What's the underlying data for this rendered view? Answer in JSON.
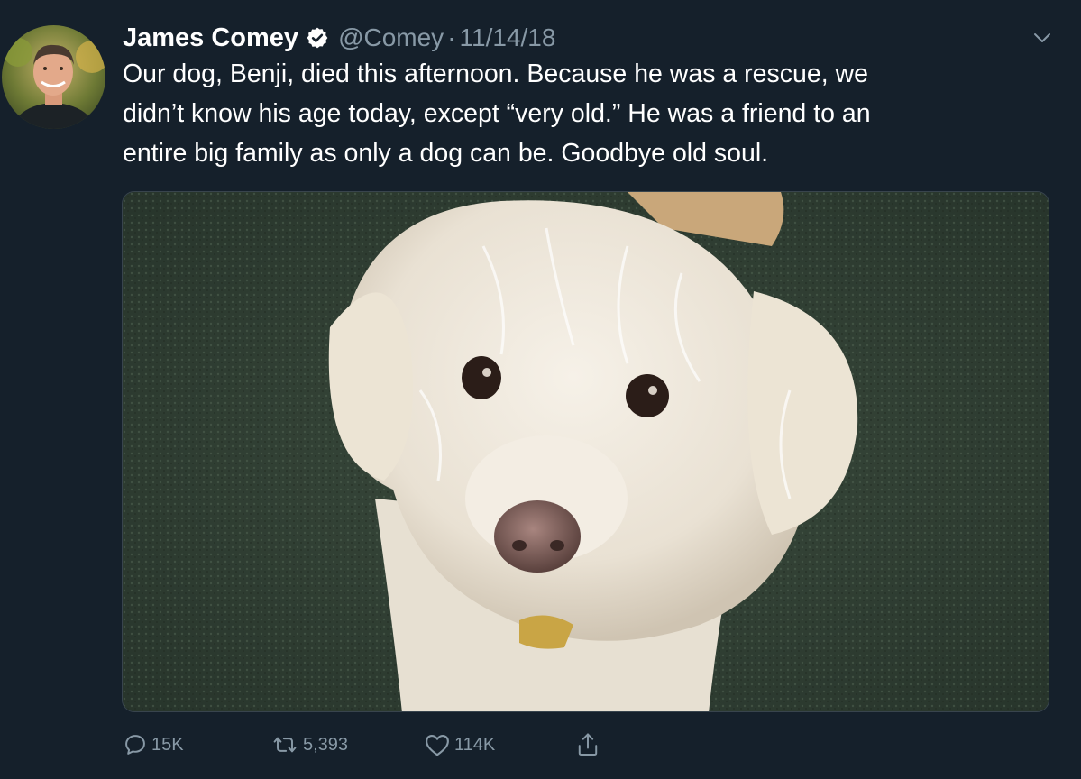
{
  "tweet": {
    "author_name": "James Comey",
    "handle": "@Comey",
    "separator": "·",
    "date": "11/14/18",
    "text_lines": [
      "Our dog, Benji, died this afternoon.  Because he was a rescue, we",
      "didn’t know his age today, except “very old.”  He was a friend to an",
      "entire big family as only a dog can be. Goodbye old soul."
    ]
  },
  "actions": {
    "replies": "15K",
    "retweets": "5,393",
    "likes": "114K"
  },
  "icons": {
    "verified": "verified-badge-icon",
    "menu": "chevron-down-icon",
    "reply": "reply-icon",
    "retweet": "retweet-icon",
    "like": "heart-icon",
    "share": "share-icon"
  },
  "colors": {
    "background": "#15202b",
    "text": "#ffffff",
    "secondary_text": "#8899a6",
    "border": "#38444d"
  }
}
